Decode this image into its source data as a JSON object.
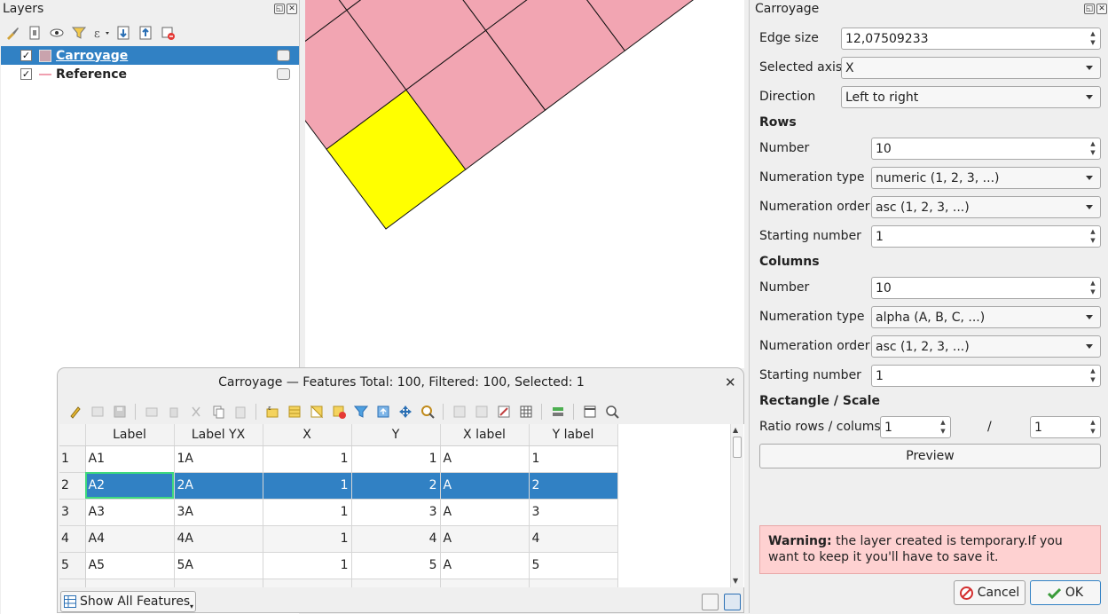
{
  "layers_panel": {
    "title": "Layers",
    "layers": [
      {
        "name": "Carroyage",
        "checked": true,
        "selected": true,
        "symbol": "polygon-fill",
        "color": "#c9a3ad"
      },
      {
        "name": "Reference",
        "checked": true,
        "selected": false,
        "symbol": "line",
        "color": "#f0a0b0"
      }
    ]
  },
  "attribute_table": {
    "title": "Carroyage — Features Total: 100, Filtered: 100, Selected: 1",
    "columns": [
      "Label",
      "Label YX",
      "X",
      "Y",
      "X label",
      "Y label"
    ],
    "rows": [
      {
        "n": "1",
        "cells": [
          "A1",
          "1A",
          "1",
          "1",
          "A",
          "1"
        ]
      },
      {
        "n": "2",
        "cells": [
          "A2",
          "2A",
          "1",
          "2",
          "A",
          "2"
        ],
        "selected": true
      },
      {
        "n": "3",
        "cells": [
          "A3",
          "3A",
          "1",
          "3",
          "A",
          "3"
        ]
      },
      {
        "n": "4",
        "cells": [
          "A4",
          "4A",
          "1",
          "4",
          "A",
          "4"
        ]
      },
      {
        "n": "5",
        "cells": [
          "A5",
          "5A",
          "1",
          "5",
          "A",
          "5"
        ]
      }
    ],
    "show_all_label": "Show All Features"
  },
  "carroyage_panel": {
    "title": "Carroyage",
    "edge_size_label": "Edge size",
    "edge_size_value": "12,07509233",
    "selected_axis_label": "Selected axis",
    "selected_axis_value": "X",
    "direction_label": "Direction",
    "direction_value": "Left to right",
    "rows_heading": "Rows",
    "rows_number_label": "Number",
    "rows_number_value": "10",
    "rows_numeration_type_label": "Numeration type",
    "rows_numeration_type_value": "numeric (1, 2, 3, ...)",
    "rows_numeration_order_label": "Numeration order",
    "rows_numeration_order_value": "asc (1, 2, 3, ...)",
    "rows_starting_label": "Starting number",
    "rows_starting_value": "1",
    "columns_heading": "Columns",
    "cols_number_label": "Number",
    "cols_number_value": "10",
    "cols_numeration_type_label": "Numeration type",
    "cols_numeration_type_value": "alpha (A, B, C, ...)",
    "cols_numeration_order_label": "Numeration order",
    "cols_numeration_order_value": "asc (1, 2, 3, ...)",
    "cols_starting_label": "Starting number",
    "cols_starting_value": "1",
    "rect_heading": "Rectangle / Scale",
    "ratio_label": "Ratio rows / colums",
    "ratio_left_value": "1",
    "ratio_sep": "/",
    "ratio_right_value": "1",
    "preview_label": "Preview",
    "warning_bold": "Warning:",
    "warning_text": " the layer created is temporary.If you want to keep it you'll have to save it.",
    "cancel_label": "Cancel",
    "ok_label": "OK"
  },
  "colors": {
    "grid_fill": "#f2a5b2",
    "grid_selected_fill": "#ffff00",
    "selection_blue": "#3181c4",
    "warning_bg": "#fed1d1"
  }
}
